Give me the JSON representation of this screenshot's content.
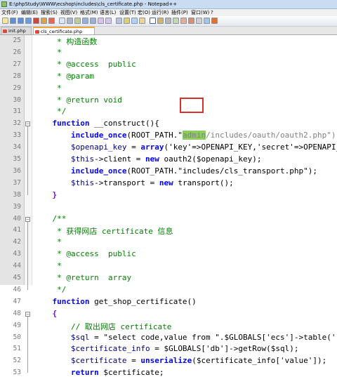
{
  "window": {
    "title": "E:\\phpStudy\\WWW\\ecshop\\includes\\cls_certificate.php - Notepad++"
  },
  "menu": [
    "文件(F)",
    "编辑(E)",
    "搜索(S)",
    "视图(V)",
    "格式(M)",
    "语言(L)",
    "设置(T)",
    "宏(O)",
    "运行(R)",
    "插件(P)",
    "窗口(W)",
    "?"
  ],
  "tabs": [
    {
      "label": "init.php",
      "active": false
    },
    {
      "label": "cls_certificate.php",
      "active": true
    }
  ],
  "colors": {
    "highlight": "#8ecc5f",
    "annotation_box": "#d8302a",
    "keyword": "#0000ff",
    "comment": "#008000"
  },
  "lines": [
    {
      "n": "25",
      "text": "     * 构造函数"
    },
    {
      "n": "26",
      "text": "     *"
    },
    {
      "n": "27",
      "text": "     * @access  public"
    },
    {
      "n": "28",
      "text": "     * @param"
    },
    {
      "n": "29",
      "text": "     *"
    },
    {
      "n": "30",
      "text": "     * @return void"
    },
    {
      "n": "31",
      "text": "     */"
    },
    {
      "n": "32",
      "pre": "    ",
      "kw1": "function",
      "mid": " __construct(){"
    },
    {
      "n": "33",
      "pre": "        ",
      "kw1": "include_once",
      "mid": "(ROOT_PATH.\"",
      "hl": "admin",
      "post": "/includes/oauth/oauth2.php\");"
    },
    {
      "n": "34",
      "pre": "        ",
      "v1": "$openapi_key",
      "mid": " = ",
      "kw1": "array",
      "post": "('key'=>OPENAPI_KEY,'secret'=>OPENAPI_"
    },
    {
      "n": "35",
      "pre": "        ",
      "v1": "$this",
      "mid": "->client = ",
      "kw1": "new",
      "post": " oauth2($openapi_key);"
    },
    {
      "n": "36",
      "pre": "        ",
      "kw1": "include_once",
      "mid": "(ROOT_PATH.\"includes/cls_transport.php\");"
    },
    {
      "n": "37",
      "pre": "        ",
      "v1": "$this",
      "mid": "->transport = ",
      "kw1": "new",
      "post": " transport();"
    },
    {
      "n": "38",
      "text": "    }"
    },
    {
      "n": "39",
      "text": ""
    },
    {
      "n": "40",
      "text": "    /**"
    },
    {
      "n": "41",
      "text": "     * 获得网店 certificate 信息"
    },
    {
      "n": "42",
      "text": "     *"
    },
    {
      "n": "43",
      "text": "     * @access  public"
    },
    {
      "n": "44",
      "text": "     *"
    },
    {
      "n": "45",
      "text": "     * @return  array"
    },
    {
      "n": "46",
      "text": "     */"
    },
    {
      "n": "47",
      "pre": "    ",
      "kw1": "function",
      "mid": " get_shop_certificate()"
    },
    {
      "n": "48",
      "text": "    {"
    },
    {
      "n": "49",
      "text": "        // 取出网店 certificate"
    },
    {
      "n": "50",
      "pre": "        ",
      "v1": "$sql",
      "mid": " = \"select code,value from \".$GLOBALS['ecs']->table('"
    },
    {
      "n": "51",
      "pre": "        ",
      "v1": "$certificate_info",
      "mid": " = $GLOBALS['db']->getRow($sql);"
    },
    {
      "n": "52",
      "pre": "        ",
      "v1": "$certificate",
      "mid": " = ",
      "kw1": "unserialize",
      "post": "($certificate_info['value']);"
    },
    {
      "n": "53",
      "pre": "        ",
      "kw1": "return",
      "mid": " $certificate;"
    }
  ]
}
